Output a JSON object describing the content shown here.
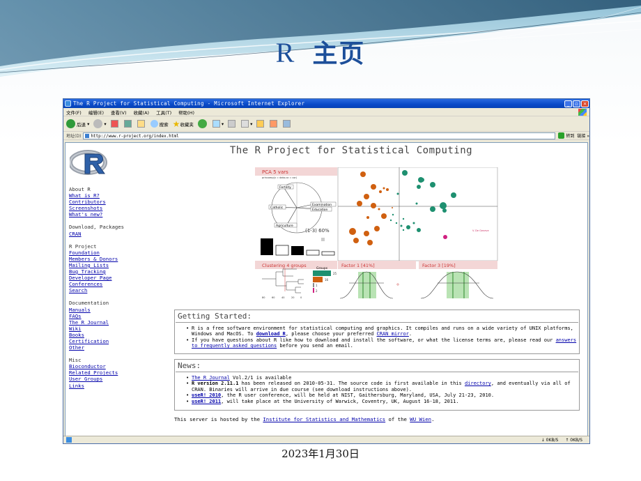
{
  "slide": {
    "title_latin": "R",
    "title_cjk": "主页",
    "date": "2023年1月30日"
  },
  "window": {
    "title": "The R Project for Statistical Computing - Microsoft Internet Explorer",
    "menu": [
      "文件(F)",
      "编辑(E)",
      "查看(V)",
      "收藏(A)",
      "工具(T)",
      "帮助(H)"
    ],
    "toolbar": {
      "back": "后退",
      "search": "搜索",
      "favorites": "收藏夹"
    },
    "address_label": "地址(D)",
    "address_value": "http://www.r-project.org/index.html",
    "go_label": "转到",
    "links_label": "链接",
    "status_left": "",
    "status_down": "0KB/S",
    "status_up": "0KB/S"
  },
  "page": {
    "heading": "The R Project for Statistical Computing",
    "sidebar": [
      {
        "heading": "About R",
        "links": [
          "What is R?",
          "Contributors",
          "Screenshots",
          "What's new?"
        ]
      },
      {
        "heading": "Download, Packages",
        "links": [
          "CRAN"
        ]
      },
      {
        "heading": "R Project",
        "links": [
          "Foundation",
          "Members & Donors",
          "Mailing Lists",
          "Bug Tracking",
          "Developer Page",
          "Conferences",
          "Search"
        ]
      },
      {
        "heading": "Documentation",
        "links": [
          "Manuals",
          "FAQs",
          "The R Journal",
          "Wiki",
          "Books",
          "Certification",
          "Other"
        ]
      },
      {
        "heading": "Misc",
        "links": [
          "Bioconductor",
          "Related Projects",
          "User Groups",
          "Links"
        ]
      }
    ],
    "figure": {
      "pca_title": "PCA  5 vars",
      "pca_sub": "princomp(x = data.ca = cor)",
      "var_labels": [
        "Fertility",
        "Catholic",
        "Examination",
        "Education",
        "Agriculture"
      ],
      "explained": "(1-3) 60%",
      "clustering_label": "Clustering  4 groups",
      "factor1_label": "Factor 1 [41%]",
      "factor3_label": "Factor 3 [19%]",
      "groups_label": "Groups",
      "group_counts": [
        "25",
        "16",
        "1",
        "2"
      ],
      "dendro_ticks": [
        "80",
        "60",
        "40",
        "20",
        "0"
      ],
      "scatter_legend": "V. De Geneve"
    },
    "getting_started": {
      "heading": "Getting Started:",
      "items": [
        {
          "pre": "R is a free software environment for statistical computing and graphics. It compiles and runs on a wide variety of UNIX platforms, Windows and MacOS. To ",
          "link1": "download R",
          "mid": ", please choose your preferred ",
          "link2": "CRAN mirror",
          "post": "."
        },
        {
          "pre": "If you have questions about R like how to download and install the software, or what the license terms are, please read our ",
          "link1": "answers to frequently asked questions",
          "post": " before you send an email."
        }
      ]
    },
    "news": {
      "heading": "News:",
      "items": [
        {
          "link": "The R Journal",
          "post": " Vol.2/1 is available"
        },
        {
          "bold": "R version 2.11.1",
          "pre": " has been released on 2010-05-31. The source code is first available in this ",
          "link": "directory",
          "post": ", and eventually via all of CRAN. Binaries will arrive in due course (see download instructions above)."
        },
        {
          "boldlink": "useR! 2010",
          "post": ", the R user conference, will be held at NIST, Gaithersburg, Maryland, USA, July 21-23, 2010."
        },
        {
          "boldlink": "useR! 2011",
          "post": ", will take place at the University of Warwick, Coventry, UK, August 16-18, 2011."
        }
      ]
    },
    "footer": {
      "pre": "This server is hosted by the ",
      "link1": "Institute for Statistics and Mathematics",
      "mid": " of the ",
      "link2": "WU Wien",
      "post": "."
    }
  }
}
